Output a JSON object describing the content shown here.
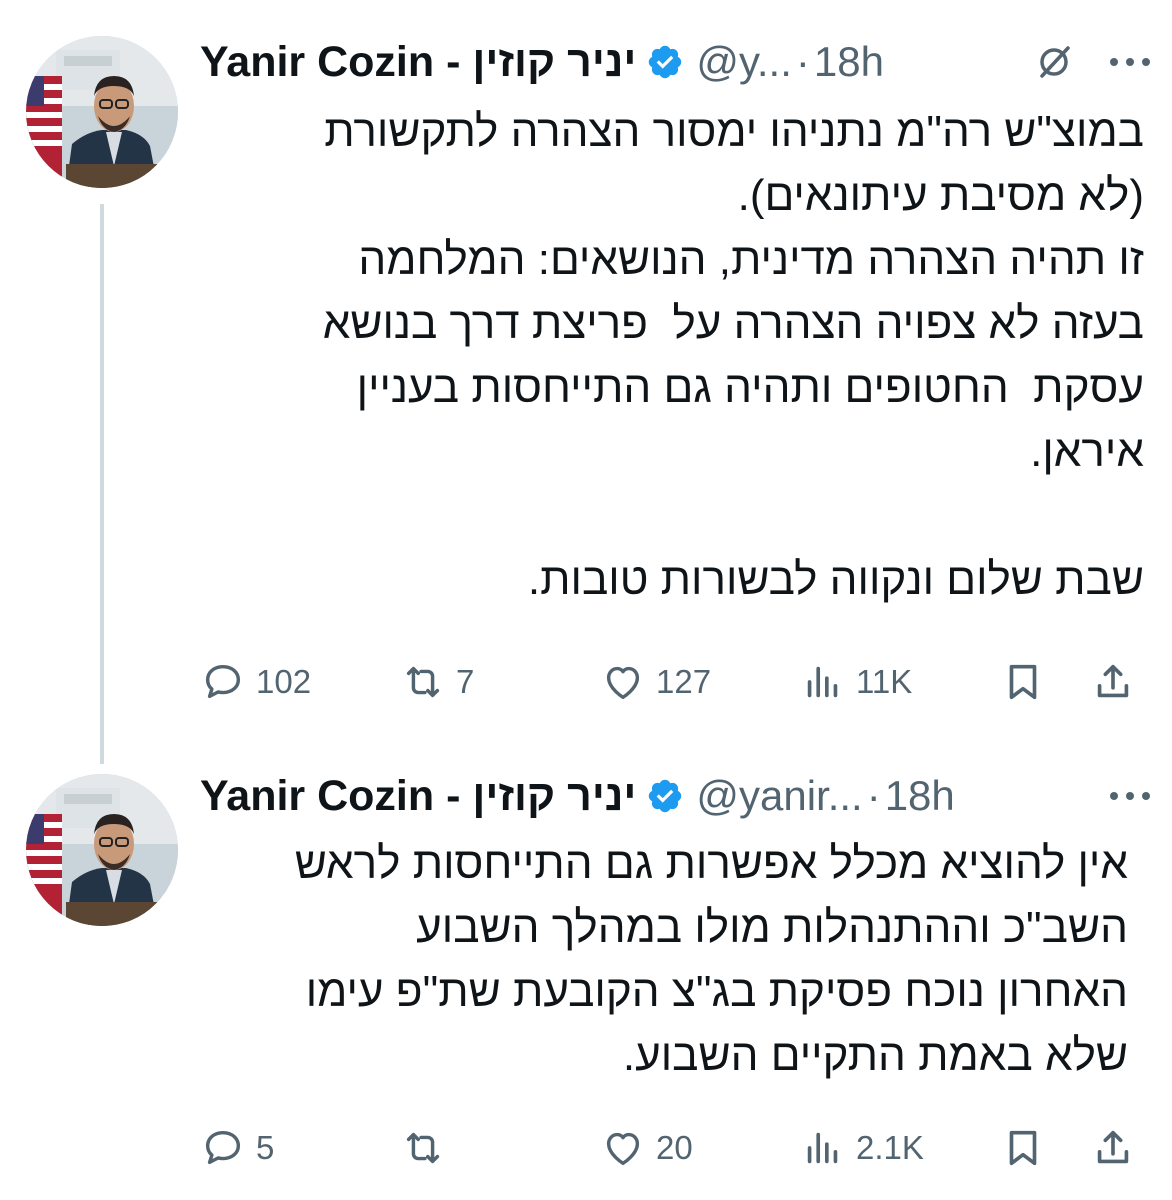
{
  "colors": {
    "text": "#0f1419",
    "muted": "#536471",
    "verified": "#1d9bf0",
    "thread_line": "#cfd9de",
    "background": "#ffffff"
  },
  "tweets": [
    {
      "author_name": "Yanir Cozin - יניר קוזין",
      "handle": "@y...",
      "separator": "·",
      "time": "18h",
      "verified_icon": "verified-badge-icon",
      "text": "במוצ\"ש רה\"מ נתניהו ימסור הצהרה לתקשורת\n(לא מסיבת עיתונאים).\nזו תהיה הצהרה מדינית, הנושאים: המלחמה\nבעזה לא צפויה הצהרה על  פריצת דרך בנושא\nעסקת  החטופים ותהיה גם התייחסות בעניין\nאיראן.\n\nשבת שלום ונקווה לבשורות טובות.",
      "replies": "102",
      "reposts": "7",
      "likes": "127",
      "views": "11K"
    },
    {
      "author_name": "Yanir Cozin - יניר קוזין",
      "handle": "@yanir...",
      "separator": "·",
      "time": "18h",
      "verified_icon": "verified-badge-icon",
      "text": "אין להוציא מכלל אפשרות גם התייחסות לראש\nהשב\"כ וההתנהלות מולו במהלך השבוע\nהאחרון נוכח פסיקת בג\"צ הקובעת שת\"פ עימו\nשלא באמת התקיים השבוע.",
      "replies": "5",
      "reposts": "",
      "likes": "20",
      "views": "2.1K"
    }
  ]
}
